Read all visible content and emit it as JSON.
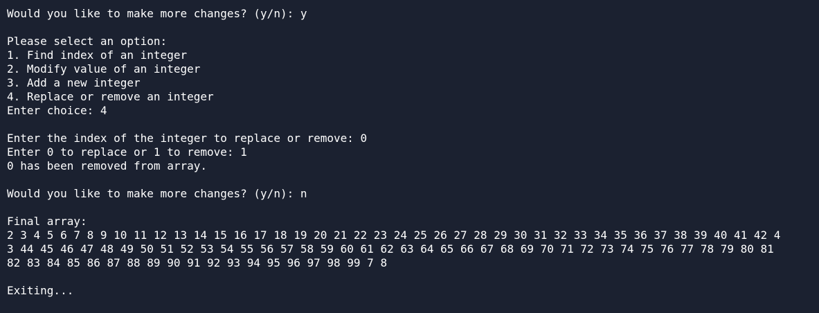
{
  "terminal": {
    "lines": [
      "Would you like to make more changes? (y/n): y",
      "",
      "Please select an option:",
      "1. Find index of an integer",
      "2. Modify value of an integer",
      "3. Add a new integer",
      "4. Replace or remove an integer",
      "Enter choice: 4",
      "",
      "Enter the index of the integer to replace or remove: 0",
      "Enter 0 to replace or 1 to remove: 1",
      "0 has been removed from array.",
      "",
      "Would you like to make more changes? (y/n): n",
      "",
      "Final array:",
      "2 3 4 5 6 7 8 9 10 11 12 13 14 15 16 17 18 19 20 21 22 23 24 25 26 27 28 29 30 31 32 33 34 35 36 37 38 39 40 41 42 4",
      "3 44 45 46 47 48 49 50 51 52 53 54 55 56 57 58 59 60 61 62 63 64 65 66 67 68 69 70 71 72 73 74 75 76 77 78 79 80 81",
      "82 83 84 85 86 87 88 89 90 91 92 93 94 95 96 97 98 99 7 8",
      "",
      "Exiting..."
    ]
  }
}
